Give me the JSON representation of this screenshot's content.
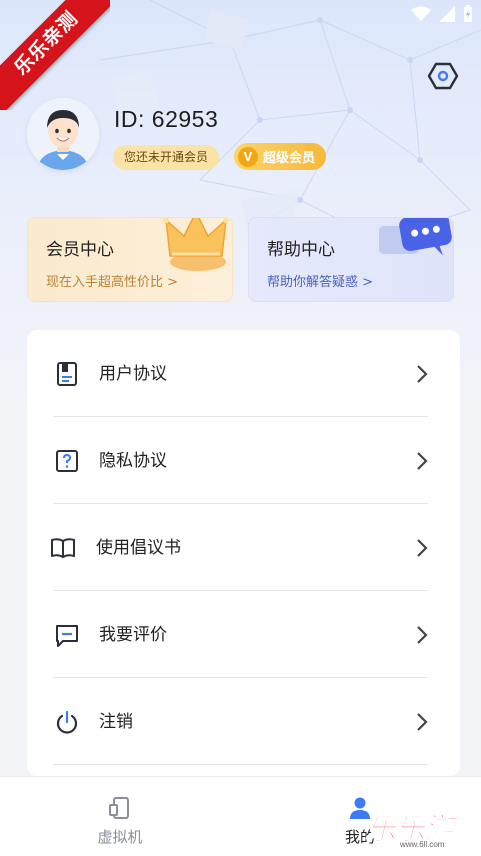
{
  "watermark": {
    "ribbon_text": "乐乐亲测",
    "corner_text": "乐乐游戏",
    "corner_url": "www.6ll.com"
  },
  "profile": {
    "user_id": "ID: 62953",
    "membership_status": "您还未开通会员",
    "vip_badge_letter": "V",
    "vip_badge_label": "超级会员"
  },
  "cards": {
    "vip": {
      "title": "会员中心",
      "subtitle": "现在入手超高性价比 >"
    },
    "help": {
      "title": "帮助中心",
      "subtitle": "帮助你解答疑惑 >"
    }
  },
  "menu": {
    "items": [
      {
        "label": "用户协议",
        "icon": "document-icon"
      },
      {
        "label": "隐私协议",
        "icon": "question-icon"
      },
      {
        "label": "使用倡议书",
        "icon": "book-icon"
      },
      {
        "label": "我要评价",
        "icon": "comment-icon"
      },
      {
        "label": "注销",
        "icon": "power-icon"
      }
    ]
  },
  "bottom_nav": {
    "items": [
      {
        "label": "虚拟机",
        "icon": "phone-icon",
        "active": false
      },
      {
        "label": "我的",
        "icon": "user-icon",
        "active": true
      }
    ]
  },
  "colors": {
    "accent": "#3d7bf3",
    "vip_gold": "#f6b93a",
    "text_primary": "#222222"
  }
}
